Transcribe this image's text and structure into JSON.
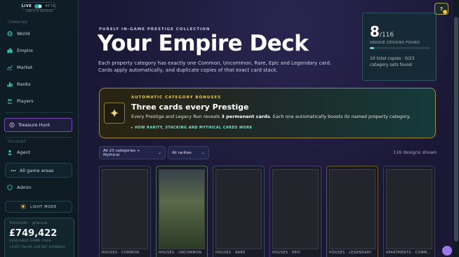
{
  "sidebar": {
    "mode": {
      "live": "LIVE",
      "beta": "BETA",
      "switch": "SWITCH WORLD"
    },
    "command_label": "COMMAND",
    "command_items": [
      {
        "label": "World",
        "icon": "globe-icon"
      },
      {
        "label": "Empire",
        "icon": "buildings-icon"
      },
      {
        "label": "Market",
        "icon": "market-icon"
      },
      {
        "label": "Ranks",
        "icon": "ranks-icon"
      },
      {
        "label": "Players",
        "icon": "players-icon"
      }
    ],
    "treasure_hunt": "Treasure Hunt",
    "account_label": "ACCOUNT",
    "agent": "Agent",
    "all_game_areas": "All game areas",
    "admin": "Admin",
    "light_mode": "LIGHT MODE",
    "treasury": {
      "label": "TREASURY",
      "user": "@Tereak",
      "amount": "£749,422",
      "sub": "AVAILABLE GAME CASH",
      "sub2": "+£507,794/HR LIVE NET EARNINGS"
    }
  },
  "header": {
    "kicker": "PURELY IN-GAME PRESTIGE COLLECTION",
    "title": "Your Empire Deck",
    "description": "Each property category has exactly one Common, Uncommon, Rare, Epic and Legendary card. Cards apply automatically, and duplicate copies of that exact card stack."
  },
  "stats": {
    "found": "8",
    "total": "/116",
    "label": "UNIQUE DESIGNS FOUND",
    "progress": 0.069,
    "footer": "10 total copies · 0/23 category sets found"
  },
  "help": {
    "label": "?"
  },
  "bonus": {
    "kicker": "AUTOMATIC CATEGORY BONUSES",
    "title": "Three cards every Prestige",
    "desc_pre": "Every Prestige and Legacy Run reveals ",
    "desc_bold": "3 permanent cards",
    "desc_post": ". Each one automatically boosts its named property category.",
    "link": "▸ HOW RARITY, STACKING AND MYTHICAL CARDS WORK"
  },
  "filters": {
    "category": "All 23 categories + Mythical",
    "rarity": "All rarities",
    "shown": "116 designs shown"
  },
  "cards": [
    {
      "label": "HOUSES · COMMON",
      "rarity": "common"
    },
    {
      "label": "HOUSES · UNCOMMON",
      "rarity": "uncommon"
    },
    {
      "label": "HOUSES · RARE",
      "rarity": "rare"
    },
    {
      "label": "HOUSES · EPIC",
      "rarity": "epic"
    },
    {
      "label": "HOUSES · LEGENDARY",
      "rarity": "legendary"
    },
    {
      "label": "APARTMENTS · COMM...",
      "rarity": "common"
    }
  ],
  "colors": {
    "accent_teal": "#58e0c2",
    "gold": "#f0c850",
    "treasure_border": "#7a4ab5"
  }
}
